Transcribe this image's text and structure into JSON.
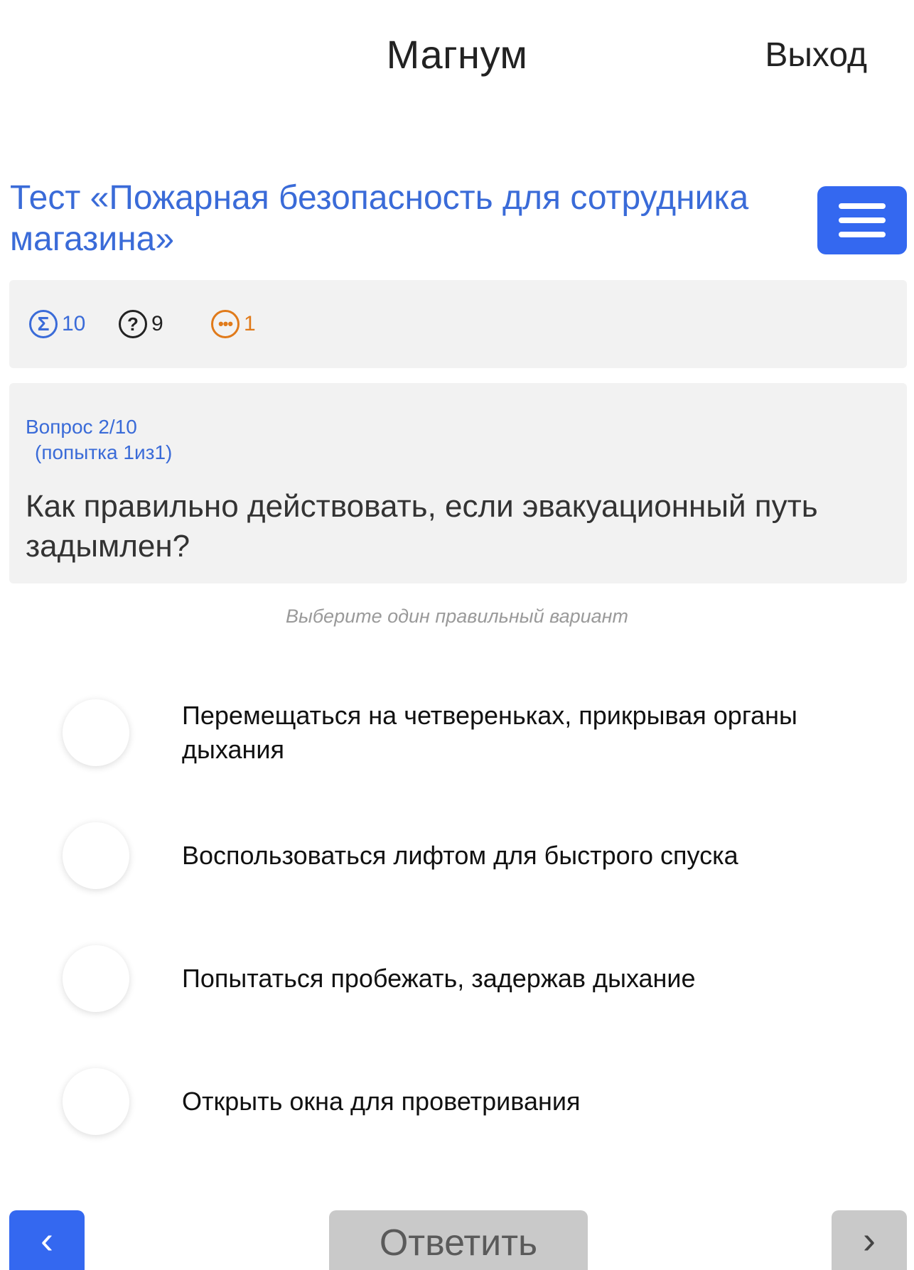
{
  "header": {
    "title": "Магнум",
    "logout_label": "Выход"
  },
  "test": {
    "title": "Тест «Пожарная безопасность для сотрудника магазина»"
  },
  "stats": {
    "total": {
      "icon": "sigma-icon",
      "glyph": "Σ",
      "value": "10",
      "color": "#3a6bd8"
    },
    "questions": {
      "icon": "question-icon",
      "glyph": "?",
      "value": "9",
      "color": "#222222"
    },
    "pending": {
      "icon": "ellipsis-icon",
      "glyph": "•••",
      "value": "1",
      "color": "#e07a1a"
    }
  },
  "question": {
    "counter": "Вопрос 2/10",
    "attempt": "(попытка 1из1)",
    "text": "Как правильно действовать, если эвакуационный путь задымлен?",
    "hint": "Выберите один правильный вариант"
  },
  "options": [
    {
      "label": "Перемещаться на четвереньках, прикрывая органы дыхания"
    },
    {
      "label": "Воспользоваться лифтом для быстрого спуска"
    },
    {
      "label": "Попытаться пробежать, задержав дыхание"
    },
    {
      "label": "Открыть окна для проветривания"
    }
  ],
  "nav": {
    "prev_glyph": "‹",
    "next_glyph": "›",
    "answer_label": "Ответить"
  },
  "colors": {
    "accent": "#3468f0",
    "link": "#3a6bd8",
    "disabled": "#c9c9c9",
    "panel": "#f2f2f2"
  }
}
